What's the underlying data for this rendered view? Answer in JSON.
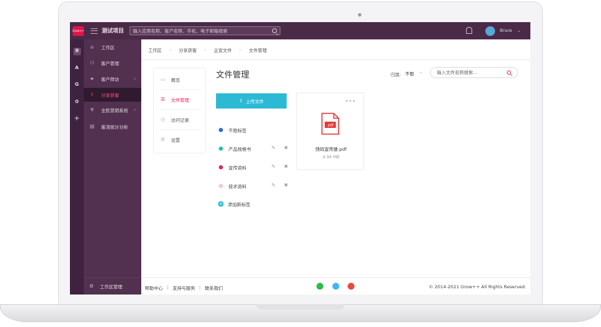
{
  "topbar": {
    "logo_text": "Grow++",
    "project_title": "测试项目",
    "search_placeholder": "输入应用名称、客户名称、手机、电子邮箱搜索",
    "user_name": "Bruce",
    "brand_color": "#4b2a48"
  },
  "rail": {
    "items": [
      "测",
      "A",
      "G",
      "✿",
      "+"
    ]
  },
  "sidebar": {
    "items": [
      {
        "label": "工作区",
        "icon": "home-icon"
      },
      {
        "label": "客户管理",
        "icon": "users-icon"
      },
      {
        "label": "客户拜访",
        "icon": "send-icon"
      },
      {
        "label": "分享获客",
        "icon": "share-icon"
      },
      {
        "label": "全民营销系统",
        "icon": "trophy-icon"
      },
      {
        "label": "客流统计分析",
        "icon": "chart-icon"
      }
    ],
    "bottom_label": "工作区管理",
    "active_color": "#ff4f7a"
  },
  "breadcrumb": [
    "工作区",
    "分享获客",
    "企宣文件",
    "文件管理"
  ],
  "left_menu": {
    "items": [
      {
        "label": "概览",
        "icon": "video-icon"
      },
      {
        "label": "文件管理",
        "icon": "list-icon"
      },
      {
        "label": "访问记录",
        "icon": "clock-icon"
      },
      {
        "label": "设置",
        "icon": "gear-icon"
      }
    ]
  },
  "main": {
    "title": "文件管理",
    "filter_label": "归属:",
    "filter_value": "不限",
    "file_search_placeholder": "输入文件名称搜索...",
    "upload_label": "上传文件",
    "accent_color": "#2cb9d4"
  },
  "tags": [
    {
      "label": "不限标签",
      "color": "#1e6fd0"
    },
    {
      "label": "产品规格书",
      "color": "#1ec3a8"
    },
    {
      "label": "宣传资料",
      "color": "#e0245e"
    },
    {
      "label": "技术资料",
      "color": "#f6c4d4"
    }
  ],
  "add_tag_label": "添加新标签",
  "file": {
    "name": "快码宣传册.pdf",
    "size": "4.94 MB",
    "type_label": ".pdf"
  },
  "footer": {
    "links": [
      "帮助中心",
      "支持与服务",
      "联系我们"
    ],
    "copyright": "© 2014-2021 Grow++ All Rights Reserved."
  }
}
